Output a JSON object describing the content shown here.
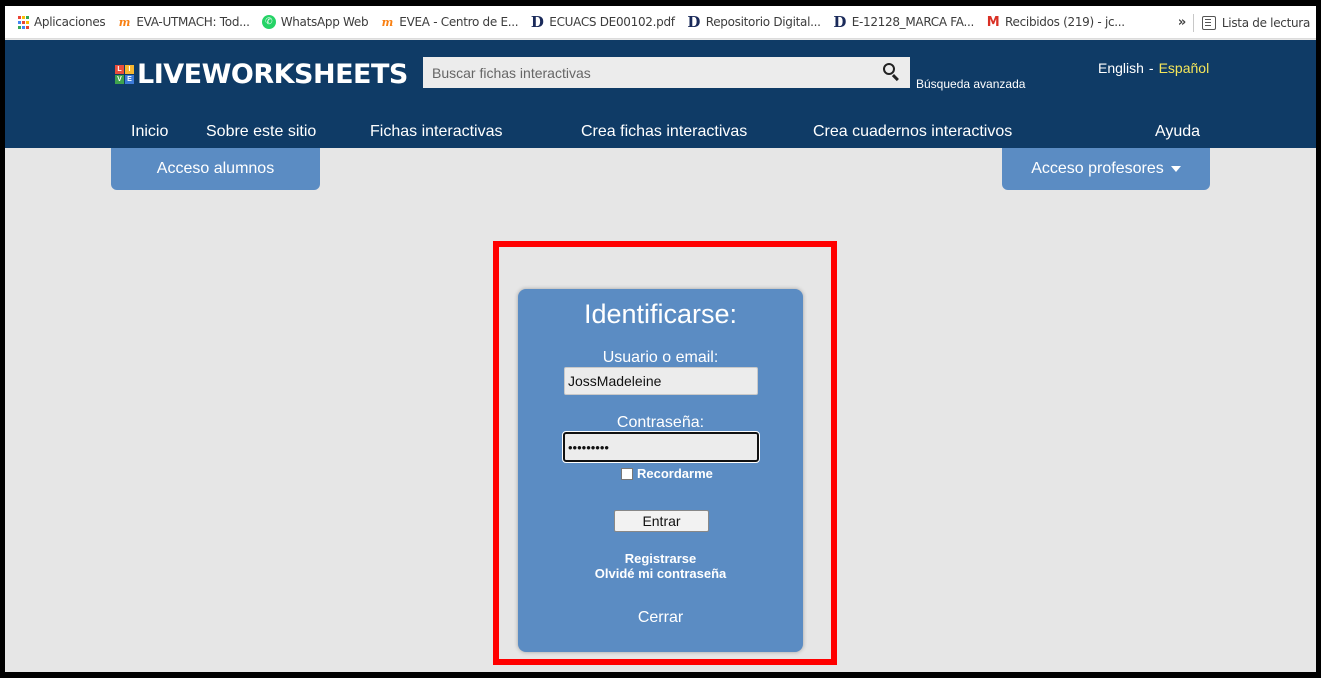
{
  "bookmarks": {
    "items": [
      {
        "label": "Aplicaciones",
        "icon": "apps-grid-icon"
      },
      {
        "label": "EVA-UTMACH: Tod...",
        "icon": "moodle-icon"
      },
      {
        "label": "WhatsApp Web",
        "icon": "whatsapp-icon"
      },
      {
        "label": "EVEA - Centro de E...",
        "icon": "moodle-icon"
      },
      {
        "label": "ECUACS DE00102.pdf",
        "icon": "dspace-icon"
      },
      {
        "label": "Repositorio Digital...",
        "icon": "dspace-icon"
      },
      {
        "label": "E-12128_MARCA FA...",
        "icon": "dspace-icon"
      },
      {
        "label": "Recibidos (219) - jc...",
        "icon": "gmail-icon"
      }
    ],
    "more": "»",
    "reading_list": "Lista de lectura"
  },
  "header": {
    "logo_mark": [
      "L",
      "I",
      "V",
      "E"
    ],
    "logo_text": "LIVEWORKSHEETS",
    "search_placeholder": "Buscar fichas interactivas",
    "advanced_search": "Búsqueda avanzada",
    "lang_en": "English",
    "lang_sep": "-",
    "lang_es": "Español"
  },
  "nav": {
    "items": [
      "Inicio",
      "Sobre este sitio",
      "Fichas interactivas",
      "Crea fichas interactivas",
      "Crea cuadernos interactivos",
      "Ayuda"
    ]
  },
  "access": {
    "students": "Acceso alumnos",
    "teachers": "Acceso profesores"
  },
  "login": {
    "title": "Identificarse:",
    "user_label": "Usuario o email:",
    "user_value": "JossMadeleine",
    "password_label": "Contraseña:",
    "password_value": "joss12345",
    "remember": "Recordarme",
    "enter": "Entrar",
    "register": "Registrarse",
    "forgot": "Olvidé mi contraseña",
    "close": "Cerrar"
  },
  "colors": {
    "header_bg": "#0f3b66",
    "panel_blue": "#5b8cc3",
    "active_lang": "#f5e65a",
    "highlight": "#ff0000"
  }
}
